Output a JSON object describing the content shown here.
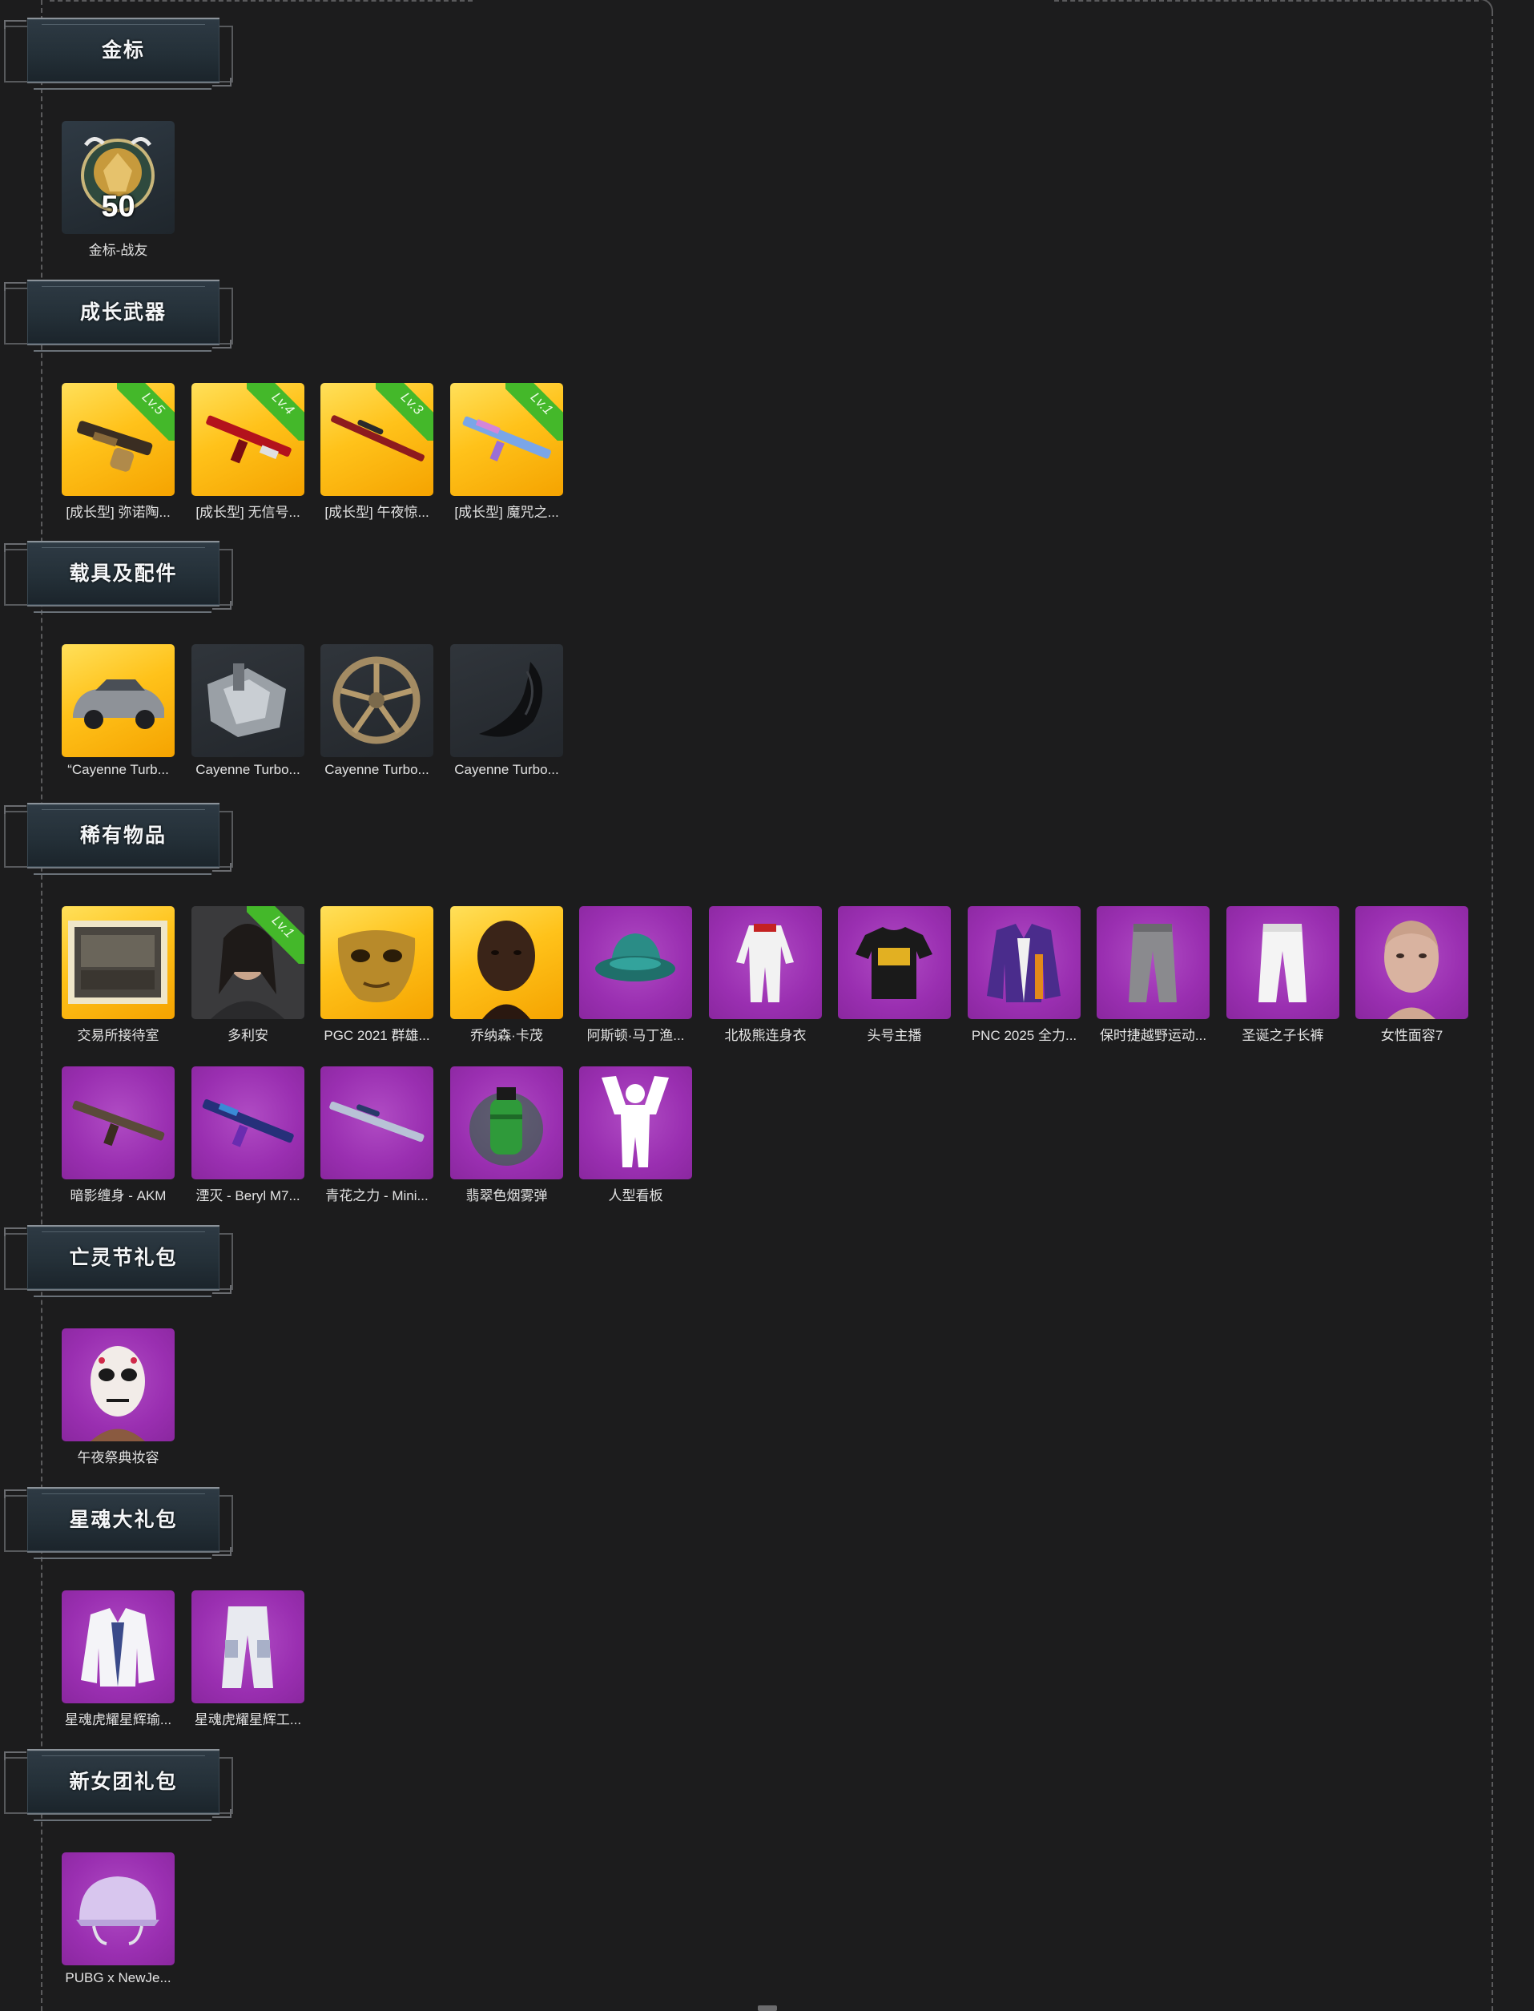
{
  "sections": [
    {
      "title": "金标",
      "items": [
        {
          "label": "金标-战友",
          "bg": "slate",
          "icon": "gold-emblem-icon",
          "number": "50"
        }
      ]
    },
    {
      "title": "成长武器",
      "items": [
        {
          "label": "[成长型] 弥诺陶...",
          "bg": "gold",
          "icon": "smg-icon",
          "level": "Lv.5"
        },
        {
          "label": "[成长型] 无信号...",
          "bg": "gold",
          "icon": "red-rifle-icon",
          "level": "Lv.4"
        },
        {
          "label": "[成长型] 午夜惊...",
          "bg": "gold",
          "icon": "sniper-rifle-icon",
          "level": "Lv.3"
        },
        {
          "label": "[成长型] 魔咒之...",
          "bg": "gold",
          "icon": "blue-rifle-icon",
          "level": "Lv.1"
        }
      ]
    },
    {
      "title": "载具及配件",
      "items": [
        {
          "label": "“Cayenne Turb...",
          "bg": "gold",
          "icon": "suv-car-icon"
        },
        {
          "label": "Cayenne Turbo...",
          "bg": "dark",
          "icon": "engine-part-icon"
        },
        {
          "label": "Cayenne Turbo...",
          "bg": "dark",
          "icon": "wheel-rim-icon"
        },
        {
          "label": "Cayenne Turbo...",
          "bg": "dark",
          "icon": "car-trim-icon"
        }
      ]
    },
    {
      "title": "稀有物品",
      "items": [
        {
          "label": "交易所接待室",
          "bg": "gold",
          "icon": "room-picture-icon"
        },
        {
          "label": "多利安",
          "bg": "dark",
          "icon": "character-portrait-icon",
          "level": "Lv.1"
        },
        {
          "label": "PGC 2021 群雄...",
          "bg": "gold",
          "icon": "gold-mask-icon"
        },
        {
          "label": "乔纳森·卡茂",
          "bg": "gold",
          "icon": "character-head-icon"
        },
        {
          "label": "阿斯顿·马丁渔...",
          "bg": "purple",
          "icon": "bucket-hat-icon"
        },
        {
          "label": "北极熊连身衣",
          "bg": "purple",
          "icon": "jumpsuit-icon"
        },
        {
          "label": "头号主播",
          "bg": "purple",
          "icon": "tshirt-icon"
        },
        {
          "label": "PNC 2025 全力...",
          "bg": "purple",
          "icon": "jacket-icon"
        },
        {
          "label": "保时捷越野运动...",
          "bg": "purple",
          "icon": "grey-pants-icon"
        },
        {
          "label": "圣诞之子长裤",
          "bg": "purple",
          "icon": "white-pants-icon"
        },
        {
          "label": "女性面容7",
          "bg": "purple",
          "icon": "female-face-icon"
        },
        {
          "label": "暗影缠身 - AKM",
          "bg": "purple",
          "icon": "akm-rifle-icon"
        },
        {
          "label": "湮灭 - Beryl M7...",
          "bg": "purple",
          "icon": "beryl-rifle-icon"
        },
        {
          "label": "青花之力 - Mini...",
          "bg": "purple",
          "icon": "mini-rifle-icon"
        },
        {
          "label": "翡翠色烟雾弹",
          "bg": "purple",
          "icon": "smoke-grenade-icon"
        },
        {
          "label": "人型看板",
          "bg": "purple",
          "icon": "standee-icon"
        }
      ]
    },
    {
      "title": "亡灵节礼包",
      "items": [
        {
          "label": "午夜祭典妆容",
          "bg": "purple",
          "icon": "skull-makeup-face-icon"
        }
      ]
    },
    {
      "title": "星魂大礼包",
      "items": [
        {
          "label": "星魂虎耀星辉瑜...",
          "bg": "purple",
          "icon": "white-jacket-icon"
        },
        {
          "label": "星魂虎耀星辉工...",
          "bg": "purple",
          "icon": "cargo-pants-icon"
        }
      ]
    },
    {
      "title": "新女团礼包",
      "items": [
        {
          "label": "PUBG x NewJe...",
          "bg": "purple",
          "icon": "helmet-icon"
        }
      ]
    }
  ]
}
